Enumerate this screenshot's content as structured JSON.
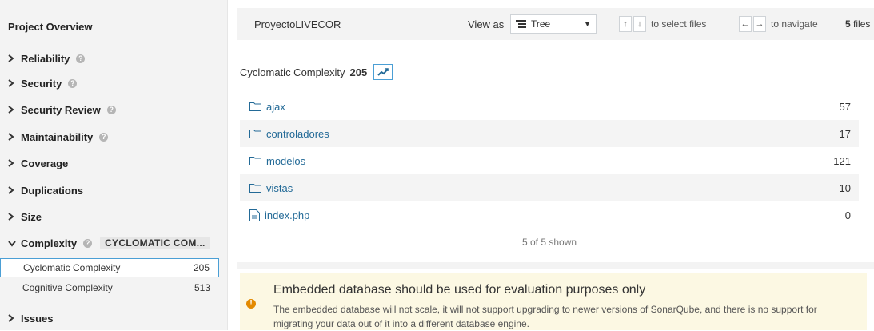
{
  "sidebar": {
    "title": "Project Overview",
    "domains": [
      {
        "label": "Reliability",
        "help": "?"
      },
      {
        "label": "Security",
        "help": "?"
      },
      {
        "label": "Security Review",
        "help": "?"
      },
      {
        "label": "Maintainability",
        "help": "?"
      },
      {
        "label": "Coverage"
      },
      {
        "label": "Duplications"
      },
      {
        "label": "Size"
      }
    ],
    "complexity": {
      "label": "Complexity",
      "help": "?",
      "badge": "CYCLOMATIC COM..."
    },
    "metrics": [
      {
        "label": "Cyclomatic Complexity",
        "value": "205"
      },
      {
        "label": "Cognitive Complexity",
        "value": "513"
      }
    ],
    "issues": {
      "label": "Issues"
    }
  },
  "topbar": {
    "project": "ProyectoLIVECOR",
    "view_as": "View as",
    "view_value": "Tree",
    "up_key": "↑",
    "down_key": "↓",
    "select_hint": "to select files",
    "left_key": "←",
    "right_key": "→",
    "navigate_hint": "to navigate",
    "files_count": "5",
    "files_label": "files"
  },
  "measure": {
    "label": "Cyclomatic Complexity",
    "value": "205"
  },
  "files": [
    {
      "name": "ajax",
      "type": "folder",
      "value": "57"
    },
    {
      "name": "controladores",
      "type": "folder",
      "value": "17"
    },
    {
      "name": "modelos",
      "type": "folder",
      "value": "121"
    },
    {
      "name": "vistas",
      "type": "folder",
      "value": "10"
    },
    {
      "name": "index.php",
      "type": "file",
      "value": "0"
    }
  ],
  "shown": "5 of 5 shown",
  "warning": {
    "icon": "!",
    "title": "Embedded database should be used for evaluation purposes only",
    "text": "The embedded database will not scale, it will not support upgrading to newer versions of SonarQube, and there is no support for migrating your data out of it into a different database engine."
  },
  "icons": {
    "chevron_right": "›",
    "chevron_down": "⌄",
    "tree": "☰",
    "caret": "▼"
  },
  "colors": {
    "link": "#236a97",
    "accent": "#4b9fd5",
    "warning_bg": "#fcf8e3",
    "warning_icon": "#e38a00"
  }
}
